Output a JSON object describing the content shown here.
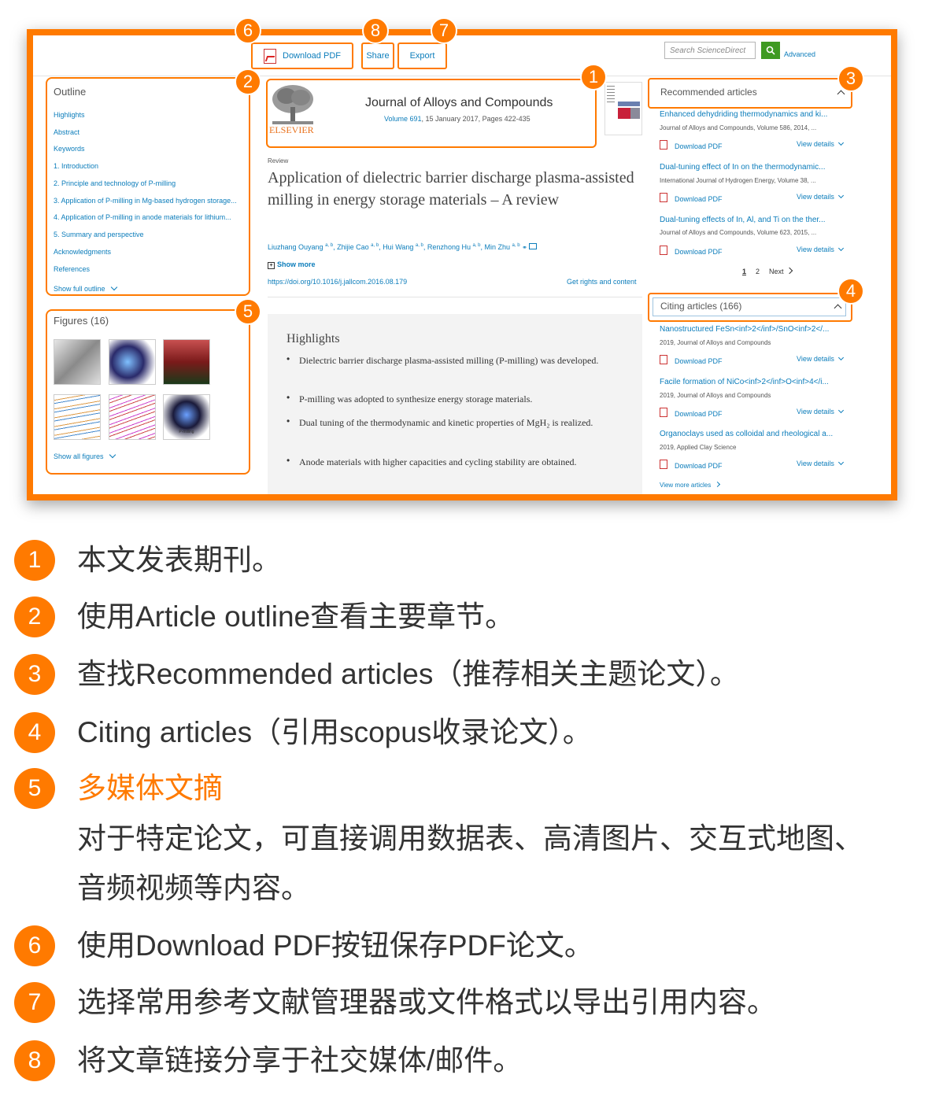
{
  "toolbar": {
    "download_pdf": "Download PDF",
    "share": "Share",
    "export": "Export",
    "search_placeholder": "Search ScienceDirect",
    "advanced": "Advanced"
  },
  "outline": {
    "title": "Outline",
    "items": [
      "Highlights",
      "Abstract",
      "Keywords",
      "1. Introduction",
      "2. Principle and technology of P-milling",
      "3. Application of P-milling in Mg-based hydrogen storage...",
      "4. Application of P-milling in anode materials for lithium...",
      "5. Summary and perspective",
      "Acknowledgments",
      "References"
    ],
    "show_full": "Show full outline"
  },
  "figures": {
    "title": "Figures (16)",
    "show_all": "Show all figures",
    "p_milling_label": "P-milling"
  },
  "article": {
    "publisher": "ELSEVIER",
    "journal": "Journal of Alloys and Compounds",
    "volume_link": "Volume 691",
    "volume_rest": ", 15 January 2017, Pages 422-435",
    "type": "Review",
    "title": "Application of dielectric barrier discharge plasma-assisted milling in energy storage materials – A review",
    "authors": [
      {
        "name": "Liuzhang Ouyang",
        "sup": "a, b"
      },
      {
        "name": "Zhijie Cao",
        "sup": "a, b"
      },
      {
        "name": "Hui Wang",
        "sup": "a, b"
      },
      {
        "name": "Renzhong Hu",
        "sup": "a, b"
      },
      {
        "name": "Min Zhu",
        "sup": "a, b"
      }
    ],
    "show_more": "Show more",
    "doi": "https://doi.org/10.1016/j.jallcom.2016.08.179",
    "rights": "Get rights and content"
  },
  "highlights": {
    "title": "Highlights",
    "items": [
      "Dielectric barrier discharge plasma-assisted milling (P-milling) was developed.",
      "P-milling was adopted to synthesize energy storage materials.",
      "Dual tuning of the thermodynamic and kinetic properties of MgH₂ is realized.",
      "Anode materials with higher capacities and cycling stability are obtained."
    ]
  },
  "recommended": {
    "title": "Recommended articles",
    "items": [
      {
        "title": "Enhanced dehydriding thermodynamics and ki...",
        "meta": "Journal of Alloys and Compounds, Volume 586, 2014, ..."
      },
      {
        "title": "Dual-tuning effect of In on the thermodynamic...",
        "meta": "International Journal of Hydrogen Energy, Volume 38, ..."
      },
      {
        "title": "Dual-tuning effects of In, Al, and Ti on the ther...",
        "meta": "Journal of Alloys and Compounds, Volume 623, 2015, ..."
      }
    ],
    "download_pdf": "Download PDF",
    "view_details": "View details",
    "pages": [
      "1",
      "2"
    ],
    "next": "Next"
  },
  "citing": {
    "title": "Citing articles (166)",
    "items": [
      {
        "title": "Nanostructured FeSn<inf>2</inf>/SnO<inf>2</...",
        "meta": "2019, Journal of Alloys and Compounds"
      },
      {
        "title": "Facile formation of NiCo<inf>2</inf>O<inf>4</i...",
        "meta": "2019, Journal of Alloys and Compounds"
      },
      {
        "title": "Organoclays used as colloidal and rheological a...",
        "meta": "2019, Applied Clay Science"
      }
    ],
    "view_more": "View more articles"
  },
  "badges": [
    "1",
    "2",
    "3",
    "4",
    "5",
    "6",
    "7",
    "8"
  ],
  "legend": [
    {
      "num": "1",
      "text": "本文发表期刊。"
    },
    {
      "num": "2",
      "text": "使用Article outline查看主要章节。"
    },
    {
      "num": "3",
      "text": "查找Recommended articles（推荐相关主题论文）。"
    },
    {
      "num": "4",
      "text": "Citing articles（引用scopus收录论文）。"
    },
    {
      "num": "5",
      "text": "多媒体文摘",
      "sub1": "对于特定论文，可直接调用数据表、高清图片、交互式地图、",
      "sub2": "音频视频等内容。"
    },
    {
      "num": "6",
      "text": "使用Download PDF按钮保存PDF论文。"
    },
    {
      "num": "7",
      "text": "选择常用参考文献管理器或文件格式以导出引用内容。"
    },
    {
      "num": "8",
      "text": "将文章链接分享于社交媒体/邮件。"
    }
  ],
  "colors": {
    "accent": "#ff7a00",
    "link": "#0c7dbb",
    "search_button": "#3f9a22"
  }
}
